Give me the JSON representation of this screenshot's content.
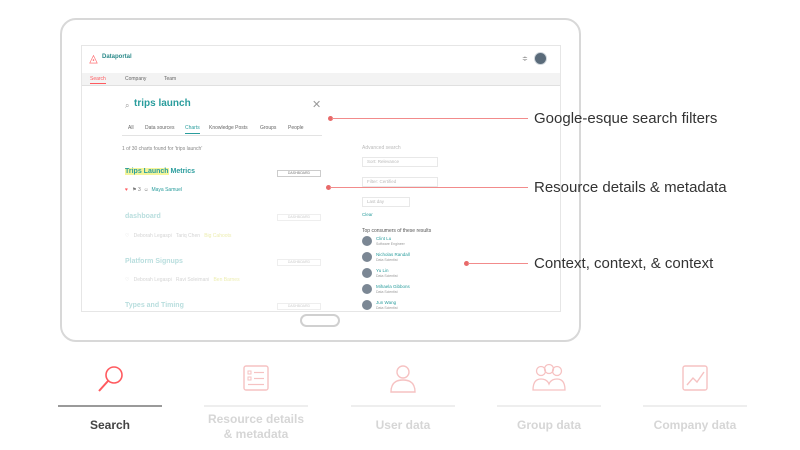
{
  "app": {
    "brand": "Dataportal",
    "logo_icon": "airbnb-logo-icon",
    "accent": "#ff5a5f",
    "teal": "#2a9d9d",
    "nav": [
      "Search",
      "Company",
      "Team"
    ]
  },
  "search": {
    "query": "trips launch",
    "tabs": [
      "All",
      "Data sources",
      "Charts",
      "Knowledge Posts",
      "Groups",
      "People"
    ],
    "active_tab": "Charts",
    "result_count": "1 of 30 charts found for 'trips launch'"
  },
  "results": [
    {
      "title_hl": "Trips Launch",
      "title_rest": " Metrics",
      "tag": "DASHBOARD",
      "meta_count": "3",
      "meta_owner": "Maya Samuel"
    },
    {
      "title": "dashboard",
      "tag": "DASHBOARD",
      "meta_1": "Deborah Legaspi",
      "meta_2": "Tariq Chen",
      "meta_3": "Big Cahoots"
    },
    {
      "title": "Platform Signups",
      "tag": "DASHBOARD",
      "meta_1": "Deborah Legaspi",
      "meta_2": "Ravi Soleimani",
      "meta_3": "Ben Barnes"
    },
    {
      "title": "Types and Timing",
      "tag": "DASHBOARD"
    }
  ],
  "advanced": {
    "label": "Advanced search",
    "sort": "Sort: Relevance",
    "filter": "Filter: Certified",
    "date": "Last day",
    "clear": "Clear"
  },
  "consumers": {
    "label": "Top consumers of these results",
    "people": [
      {
        "name": "Clint Lu",
        "role": "Software Engineer"
      },
      {
        "name": "Nicholas Randall",
        "role": "Data Scientist"
      },
      {
        "name": "Yu Lin",
        "role": "Data Scientist"
      },
      {
        "name": "Mihaela Gibbons",
        "role": "Data Scientist"
      },
      {
        "name": "Jun Wang",
        "role": "Data Scientist"
      }
    ]
  },
  "callouts": [
    "Google-esque search filters",
    "Resource details & metadata",
    "Context, context, & context"
  ],
  "features": [
    {
      "label": "Search",
      "icon": "magnifier-icon",
      "active": true
    },
    {
      "label": "Resource details\n& metadata",
      "icon": "document-list-icon",
      "active": false
    },
    {
      "label": "User data",
      "icon": "user-icon",
      "active": false
    },
    {
      "label": "Group data",
      "icon": "group-icon",
      "active": false
    },
    {
      "label": "Company data",
      "icon": "chart-icon",
      "active": false
    }
  ]
}
